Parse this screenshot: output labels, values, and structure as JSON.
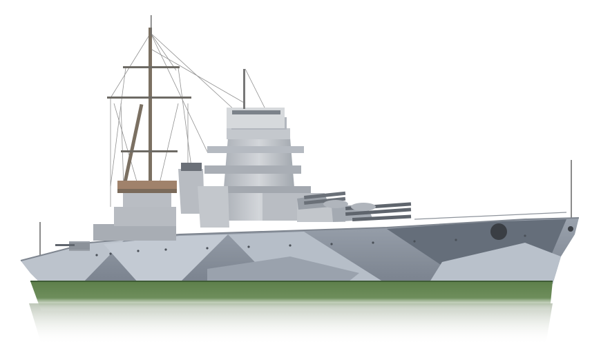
{
  "image": {
    "subject": "warship-render",
    "background_color": "#ffffff",
    "colors": {
      "hull_light": "#b9c1cb",
      "hull_dark": "#6f7783",
      "hull_mid": "#8e96a2",
      "superstructure": "#c4c8cd",
      "superstructure_shadow": "#8a9098",
      "waterline_green": "#5d7f4a",
      "waterline_dark": "#3e5b35",
      "mast": "#7b7062",
      "rigging": "#8c8c8c",
      "deck": "#9aa0a8",
      "platform_rust": "#a0826b"
    }
  }
}
